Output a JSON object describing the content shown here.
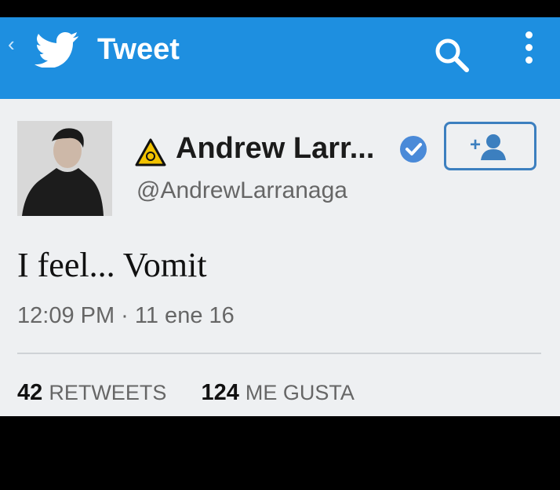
{
  "toolbar": {
    "title": "Tweet",
    "back_icon": "chevron-left-icon",
    "logo_icon": "twitter-bird-icon",
    "search_icon": "search-icon",
    "menu_icon": "overflow-menu-icon",
    "color": "#1e8fe0"
  },
  "tweet": {
    "name": "Andrew Larr...",
    "handle": "@AndrewLarranaga",
    "text": "I feel... Vomit",
    "timestamp": "12:09 PM · 11 ene 16",
    "verified": true
  },
  "stats": {
    "retweets_count": "42",
    "retweets_label": "RETWEETS",
    "likes_count": "124",
    "likes_label": "ME GUSTA"
  },
  "colors": {
    "brand": "#1e8fe0",
    "verified": "#4a8ad8",
    "follow_border": "#3c7fbf"
  }
}
